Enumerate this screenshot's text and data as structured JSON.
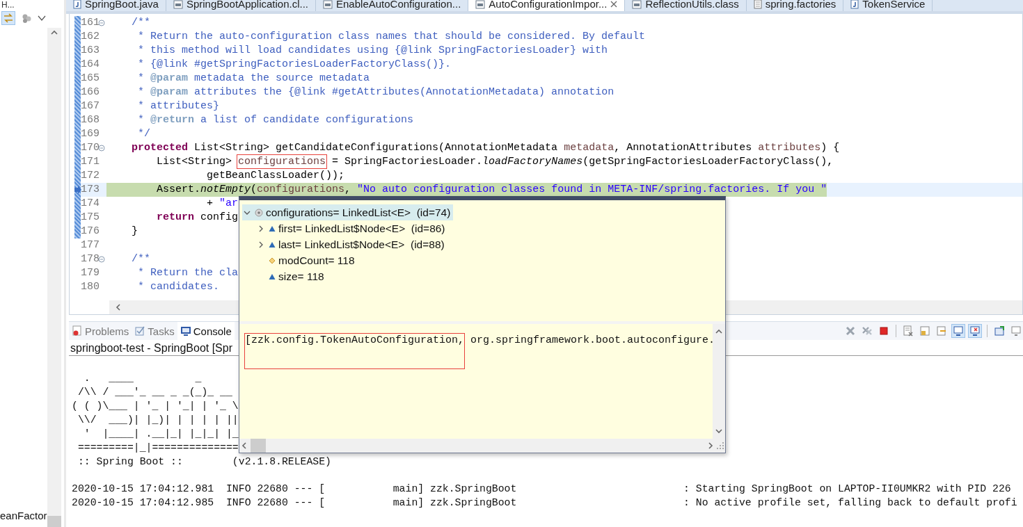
{
  "sidebar": {
    "title": "H...",
    "bottom_text": "eanFactor"
  },
  "editor_tabs": [
    {
      "label": "SpringBoot.java",
      "kind": "java",
      "selected": false
    },
    {
      "label": "SpringBootApplication.cl...",
      "kind": "class",
      "selected": false
    },
    {
      "label": "EnableAutoConfiguration...",
      "kind": "class",
      "selected": false
    },
    {
      "label": "AutoConfigurationImpor...",
      "kind": "class",
      "selected": true
    },
    {
      "label": "ReflectionUtils.class",
      "kind": "class",
      "selected": false
    },
    {
      "label": "spring.factories",
      "kind": "text",
      "selected": false
    },
    {
      "label": "TokenService",
      "kind": "java",
      "selected": false
    }
  ],
  "code_lines": [
    {
      "number": "161",
      "fold": true,
      "current": false,
      "segments": [
        {
          "kind": "comment",
          "text": "    /**"
        }
      ]
    },
    {
      "number": "162",
      "fold": false,
      "current": false,
      "segments": [
        {
          "kind": "comment",
          "text": "     * Return the auto-configuration class names that should be considered. By default"
        }
      ]
    },
    {
      "number": "163",
      "fold": false,
      "current": false,
      "segments": [
        {
          "kind": "comment",
          "text": "     * this method will load candidates using {@link SpringFactoriesLoader} with"
        }
      ]
    },
    {
      "number": "164",
      "fold": false,
      "current": false,
      "segments": [
        {
          "kind": "comment",
          "text": "     * {@link #getSpringFactoriesLoaderFactoryClass()}."
        }
      ]
    },
    {
      "number": "165",
      "fold": false,
      "current": false,
      "segments": [
        {
          "kind": "comment",
          "text": "     * "
        },
        {
          "kind": "doctag",
          "text": "@param"
        },
        {
          "kind": "comment",
          "text": " metadata the source metadata"
        }
      ]
    },
    {
      "number": "166",
      "fold": false,
      "current": false,
      "segments": [
        {
          "kind": "comment",
          "text": "     * "
        },
        {
          "kind": "doctag",
          "text": "@param"
        },
        {
          "kind": "comment",
          "text": " attributes the {@link #getAttributes(AnnotationMetadata) annotation"
        }
      ]
    },
    {
      "number": "167",
      "fold": false,
      "current": false,
      "segments": [
        {
          "kind": "comment",
          "text": "     * attributes}"
        }
      ]
    },
    {
      "number": "168",
      "fold": false,
      "current": false,
      "segments": [
        {
          "kind": "comment",
          "text": "     * "
        },
        {
          "kind": "doctag",
          "text": "@return"
        },
        {
          "kind": "comment",
          "text": " a list of candidate configurations"
        }
      ]
    },
    {
      "number": "169",
      "fold": false,
      "current": false,
      "segments": [
        {
          "kind": "comment",
          "text": "     */"
        }
      ]
    },
    {
      "number": "170",
      "fold": true,
      "current": false,
      "segments": [
        {
          "kind": "keyword",
          "text": "    protected"
        },
        {
          "kind": "plain",
          "text": " List<String> getCandidateConfigurations(AnnotationMetadata "
        },
        {
          "kind": "variable",
          "text": "metadata"
        },
        {
          "kind": "plain",
          "text": ", AnnotationAttributes "
        },
        {
          "kind": "variable",
          "text": "attributes"
        },
        {
          "kind": "plain",
          "text": ") {"
        }
      ]
    },
    {
      "number": "171",
      "fold": false,
      "current": false,
      "segments": [
        {
          "kind": "plain",
          "text": "        List<String> "
        },
        {
          "kind": "boxed",
          "text": "configurations"
        },
        {
          "kind": "plain",
          "text": " = SpringFactoriesLoader."
        },
        {
          "kind": "italic",
          "text": "loadFactoryNames"
        },
        {
          "kind": "plain",
          "text": "(getSpringFactoriesLoaderFactoryClass(),"
        }
      ]
    },
    {
      "number": "172",
      "fold": false,
      "current": false,
      "segments": [
        {
          "kind": "plain",
          "text": "                getBeanClassLoader());"
        }
      ]
    },
    {
      "number": "173",
      "fold": false,
      "current": true,
      "segments": [
        {
          "kind": "plain",
          "text": "        Assert."
        },
        {
          "kind": "italic",
          "text": "notEmpty"
        },
        {
          "kind": "plain",
          "text": "("
        },
        {
          "kind": "variable",
          "text": "configurations"
        },
        {
          "kind": "plain",
          "text": ", "
        },
        {
          "kind": "string",
          "text": "\"No auto configuration classes found in META-INF/spring.factories. If you \""
        }
      ]
    },
    {
      "number": "174",
      "fold": false,
      "current": false,
      "segments": [
        {
          "kind": "plain",
          "text": "                + "
        },
        {
          "kind": "string",
          "text": "\"ar"
        }
      ]
    },
    {
      "number": "175",
      "fold": false,
      "current": false,
      "segments": [
        {
          "kind": "keyword",
          "text": "        return"
        },
        {
          "kind": "plain",
          "text": " config"
        }
      ]
    },
    {
      "number": "176",
      "fold": false,
      "current": false,
      "segments": [
        {
          "kind": "plain",
          "text": "    }"
        }
      ]
    },
    {
      "number": "177",
      "fold": false,
      "current": false
    },
    {
      "number": "178",
      "fold": true,
      "current": false,
      "segments": [
        {
          "kind": "comment",
          "text": "    /**"
        }
      ]
    },
    {
      "number": "179",
      "fold": false,
      "current": false,
      "segments": [
        {
          "kind": "comment",
          "text": "     * Return the cla"
        }
      ]
    },
    {
      "number": "180",
      "fold": false,
      "current": false,
      "segments": [
        {
          "kind": "comment",
          "text": "     * candidates."
        }
      ]
    }
  ],
  "debug_popup": {
    "tree": [
      {
        "label": "configurations= LinkedList<E>  (id=74)",
        "kind": "local",
        "expandable": true,
        "expanded": true,
        "selected": true,
        "children": [
          {
            "label": "first= LinkedList$Node<E>  (id=86)",
            "kind": "field",
            "expandable": true,
            "expanded": false,
            "selected": false
          },
          {
            "label": "last= LinkedList$Node<E>  (id=88)",
            "kind": "field",
            "expandable": true,
            "expanded": false,
            "selected": false
          },
          {
            "label": "modCount= 118",
            "kind": "default_field",
            "expandable": false,
            "selected": false
          },
          {
            "label": "size= 118",
            "kind": "field",
            "expandable": false,
            "selected": false
          }
        ]
      }
    ],
    "detail": [
      {
        "kind": "boxed",
        "text": "[zzk.config.TokenAutoConfiguration,"
      },
      {
        "kind": "plain",
        "text": " org.springframework.boot.autoconfigure."
      }
    ]
  },
  "console": {
    "tabs": [
      {
        "label": "Problems",
        "kind": "problems",
        "selected": false
      },
      {
        "label": "Tasks",
        "kind": "tasks",
        "selected": false
      },
      {
        "label": "Console",
        "kind": "console",
        "selected": true
      }
    ],
    "title": "springboot-test - SpringBoot [Spr",
    "output": [
      {
        "kind": "banner",
        "text": "  .   ____          _"
      },
      {
        "kind": "banner",
        "text": " /\\\\ / ___'_ __ _ _(_)_ __"
      },
      {
        "kind": "banner",
        "text": "( ( )\\___ | '_ | '_| | '_ \\"
      },
      {
        "kind": "banner",
        "text": " \\\\/  ___)| |_)| | | | | ||"
      },
      {
        "kind": "banner",
        "text": "  '  |____| .__|_| |_|_| |_"
      },
      {
        "kind": "banner",
        "text": " =========|_|=============="
      },
      {
        "kind": "banner",
        "text": " :: Spring Boot ::        (v2.1.8.RELEASE)"
      },
      {
        "kind": "log",
        "text": "2020-10-15 17:04:12.981  INFO 22680 --- [           main] zzk.SpringBoot                           : Starting SpringBoot on LAPTOP-II0UMKR2 with PID 226"
      },
      {
        "kind": "log",
        "text": "2020-10-15 17:04:12.985  INFO 22680 --- [           main] zzk.SpringBoot                           : No active profile set, falling back to default profi"
      }
    ]
  }
}
